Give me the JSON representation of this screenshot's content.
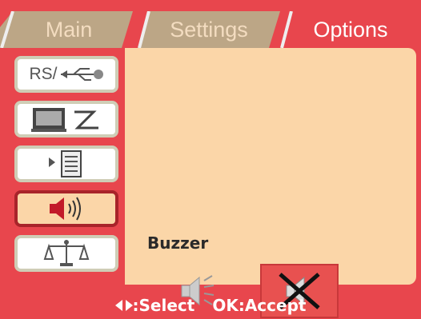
{
  "tabs": [
    {
      "label": "Main"
    },
    {
      "label": "Settings"
    },
    {
      "label": "Options"
    }
  ],
  "sidebar": {
    "items": [
      {
        "name": "interface",
        "text": "RS/"
      },
      {
        "name": "display"
      },
      {
        "name": "menu"
      },
      {
        "name": "sound"
      },
      {
        "name": "balance"
      }
    ]
  },
  "content": {
    "label": "Buzzer",
    "options": [
      {
        "name": "sound-on",
        "selected": false
      },
      {
        "name": "sound-off",
        "selected": true
      }
    ]
  },
  "footer": {
    "select_text": ":Select",
    "accept_text": "OK:Accept"
  },
  "colors": {
    "background": "#e8464d",
    "panel": "#fbd6a8",
    "active_tab_text": "#ffffff",
    "inactive_tab_text": "#f3dcc0",
    "selected_option": "#e85150"
  }
}
